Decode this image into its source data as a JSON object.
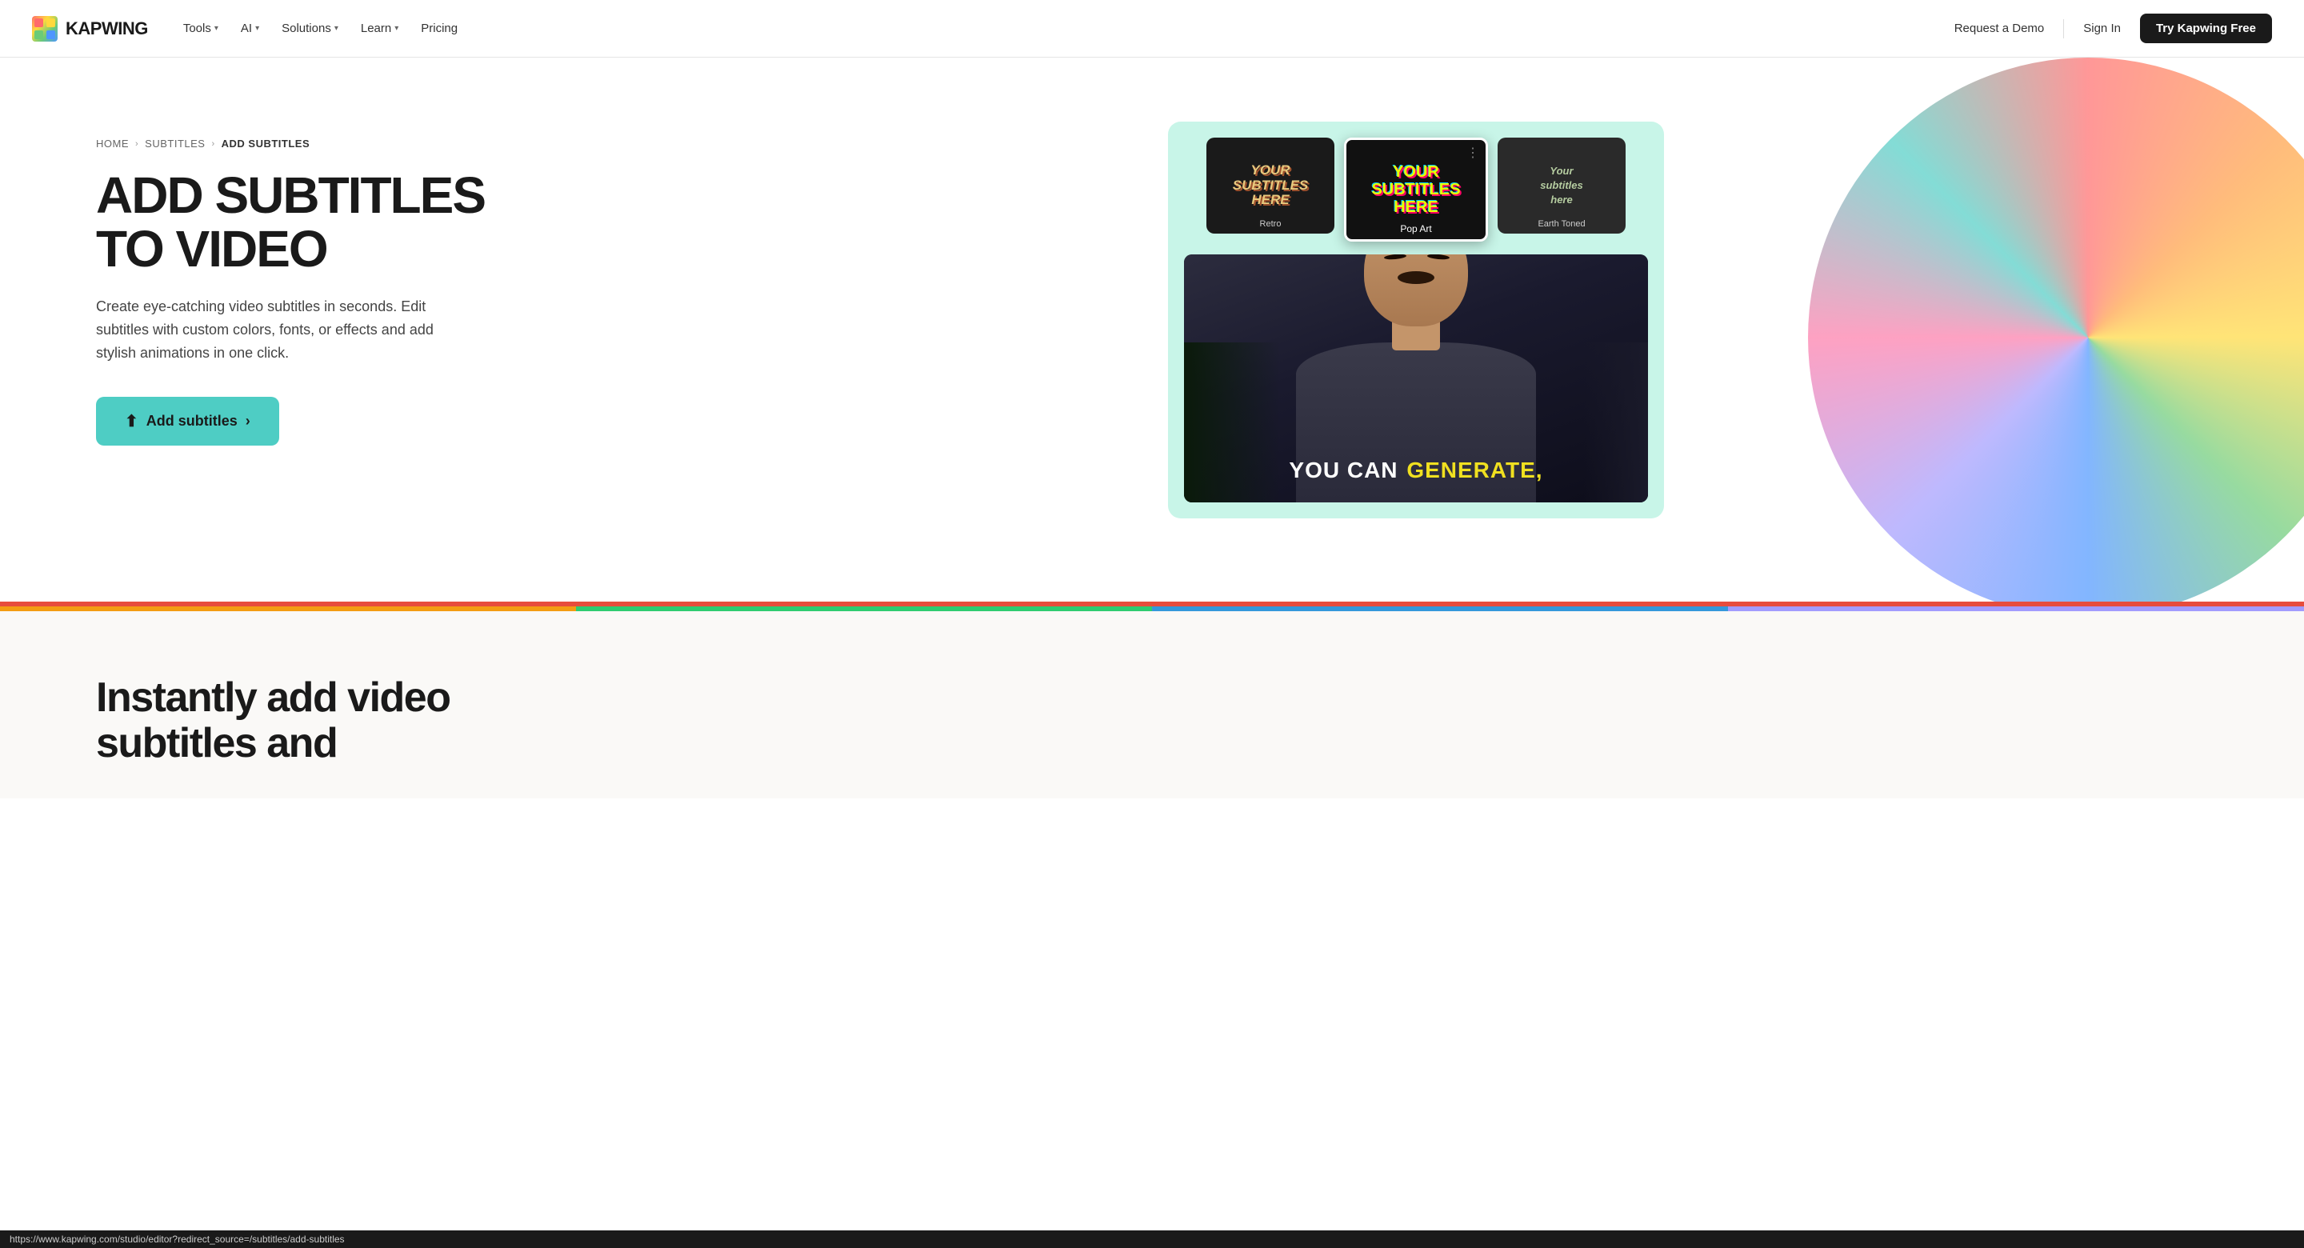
{
  "nav": {
    "logo_text": "KAPWING",
    "items": [
      {
        "label": "Tools",
        "has_dropdown": true
      },
      {
        "label": "AI",
        "has_dropdown": true
      },
      {
        "label": "Solutions",
        "has_dropdown": true
      },
      {
        "label": "Learn",
        "has_dropdown": true
      },
      {
        "label": "Pricing",
        "has_dropdown": false
      }
    ],
    "request_demo": "Request a Demo",
    "sign_in": "Sign In",
    "try_free": "Try Kapwing Free"
  },
  "breadcrumb": {
    "home": "HOME",
    "subtitles": "SUBTITLES",
    "current": "ADD SUBTITLES"
  },
  "hero": {
    "title_line1": "ADD SUBTITLES",
    "title_line2": "TO VIDEO",
    "description": "Create eye-catching video subtitles in seconds. Edit subtitles with custom colors, fonts, or effects and add stylish animations in one click.",
    "cta_button": "Add subtitles"
  },
  "style_thumbs": [
    {
      "id": "retro",
      "label": "Retro",
      "text": "YOUR\nSUBTITLES\nHERE",
      "active": false
    },
    {
      "id": "popart",
      "label": "Pop Art",
      "text": "YOUR\nSUBTITLES\nHERE",
      "active": true
    },
    {
      "id": "earth",
      "label": "Earth Toned",
      "text": "Your\nsubtitles\nhere",
      "active": false
    }
  ],
  "video": {
    "subtitle_white": "YOU CAN",
    "subtitle_yellow": "GENERATE,"
  },
  "bottom": {
    "title": "Instantly add video subtitles and"
  },
  "status_bar": {
    "url": "https://www.kapwing.com/studio/editor?redirect_source=/subtitles/add-subtitles"
  }
}
